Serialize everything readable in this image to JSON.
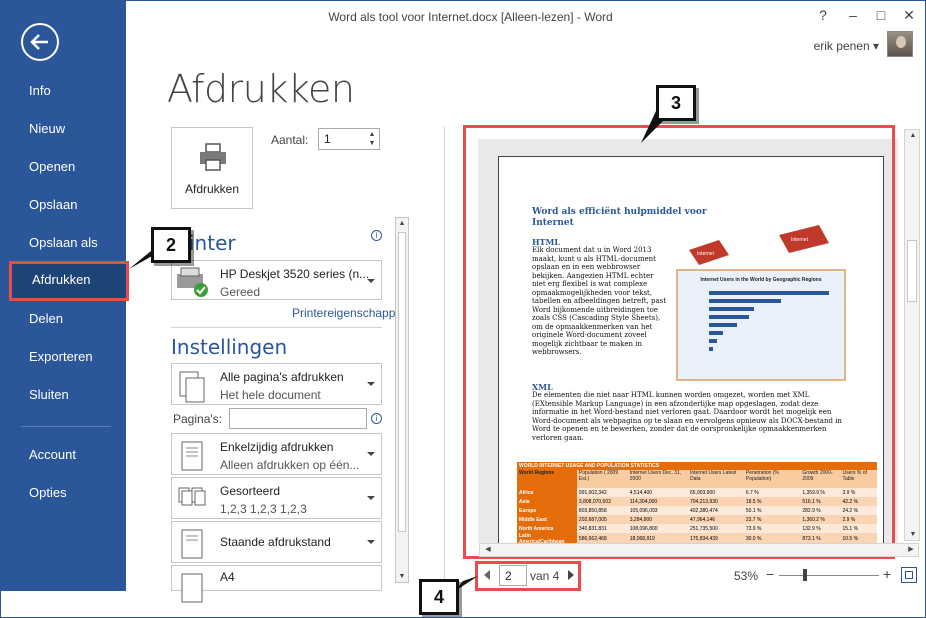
{
  "window": {
    "title": "Word als tool voor Internet.docx [Alleen-lezen] - Word",
    "help": "?",
    "minimize": "–",
    "maximize": "□",
    "close": "✕"
  },
  "user": {
    "name": "erik penen ▾"
  },
  "sidebar": {
    "back_icon": "back-arrow-icon",
    "items": [
      {
        "label": "Info"
      },
      {
        "label": "Nieuw"
      },
      {
        "label": "Openen"
      },
      {
        "label": "Opslaan"
      },
      {
        "label": "Opslaan als"
      },
      {
        "label": "Afdrukken",
        "active": true
      },
      {
        "label": "Delen"
      },
      {
        "label": "Exporteren"
      },
      {
        "label": "Sluiten"
      },
      {
        "label": "Account"
      },
      {
        "label": "Opties"
      }
    ]
  },
  "main": {
    "title": "Afdrukken",
    "print_button": "Afdrukken",
    "copies_label": "Aantal:",
    "copies_value": "1",
    "printer_heading": "inter",
    "printer": {
      "name": "HP Deskjet 3520 series (n...",
      "status": "Gereed"
    },
    "printer_properties": "Printereigenschappen",
    "settings_heading": "Instellingen",
    "settings": [
      {
        "line1": "Alle pagina's afdrukken",
        "line2": "Het hele document"
      },
      {
        "line1": "Enkelzijdig afdrukken",
        "line2": "Alleen afdrukken op één..."
      },
      {
        "line1": "Gesorteerd",
        "line2": "1,2,3    1,2,3    1,2,3"
      },
      {
        "line1": "Staande afdrukstand",
        "line2": ""
      },
      {
        "line1": "A4",
        "line2": ""
      }
    ],
    "pages_label": "Pagina's:",
    "info_glyph": "i"
  },
  "preview": {
    "doc_heading": "Word als efficiënt hulpmiddel voor Internet",
    "html_heading": "HTML",
    "html_body": "Elk document dat u in Word 2013 maakt, kunt u als HTML-document opslaan en in een webbrowser bekijken. Aangezien HTML echter niet erg flexibel is wat complexe opmaakmogelijkheden voor tekst, tabellen en afbeeldingen betreft, past Word bijkomende uitbreidingen toe zoals CSS (Cascading Style Sheets), om de opmaakkenmerken van het originele Word-document zoveel mogelijk zichtbaar te maken in webbrowsers.",
    "xml_heading": "XML",
    "xml_body": "De elementen die niet naar HTML kunnen worden omgezet, worden met XML (EXtensible Markup Language) in een afzonderlijke map opgeslagen, zodat deze informatie in het Word-bestand niet verloren gaat. Daardoor wordt het mogelijk een Word-document als webpagina op te slaan en vervolgens opnieuw als DOCX-bestand in Word te openen en te bewerken, zonder dat de oorspronkelijke opmaakkenmerken verloren gaan.",
    "chart_title": "Internet Users in the World by Geographic Regions",
    "chart_tag_left": "Internet",
    "chart_tag_right": "Internet",
    "table_title": "WORLD INTERNET USAGE AND POPULATION STATISTICS",
    "table_headers": [
      "World Regions",
      "Population ( 2009 Est.)",
      "Internet Users Dec. 31, 2000",
      "Internet Users Latest Data",
      "Penetration (% Population)",
      "Growth 2000-2009",
      "Users % of Table"
    ],
    "table_rows": [
      [
        "Africa",
        "991,002,342",
        "4,514,400",
        "65,903,900",
        "6.7 %",
        "1,359.9 %",
        "3.9 %"
      ],
      [
        "Asia",
        "3,808,070,503",
        "114,304,000",
        "704,213,930",
        "18.5 %",
        "516.1 %",
        "42.2 %"
      ],
      [
        "Europe",
        "803,850,858",
        "105,096,093",
        "402,380,474",
        "50.1 %",
        "282.9 %",
        "24.2 %"
      ],
      [
        "Middle East",
        "202,687,005",
        "3,284,800",
        "47,964,146",
        "23.7 %",
        "1,360.2 %",
        "2.9 %"
      ],
      [
        "North America",
        "340,831,831",
        "108,096,800",
        "251,735,500",
        "73.9 %",
        "132.9 %",
        "15.1 %"
      ],
      [
        "Latin America/Caribbean",
        "586,662,468",
        "18,068,919",
        "175,834,439",
        "30.0 %",
        "873.1 %",
        "10.5 %"
      ],
      [
        "Oceania / Australia",
        "34,700,201",
        "7,620,480",
        "20,838,019",
        "60.1 %",
        "173.4 %",
        "1.2 %"
      ]
    ],
    "page_current": "2",
    "page_of": "van 4",
    "zoom": "53%",
    "zoom_minus": "−",
    "zoom_plus": "+"
  },
  "callouts": [
    "2",
    "3",
    "4"
  ],
  "colors": {
    "accent": "#2b579a",
    "highlight": "#e84c4c",
    "table_orange": "#e46c0a"
  }
}
